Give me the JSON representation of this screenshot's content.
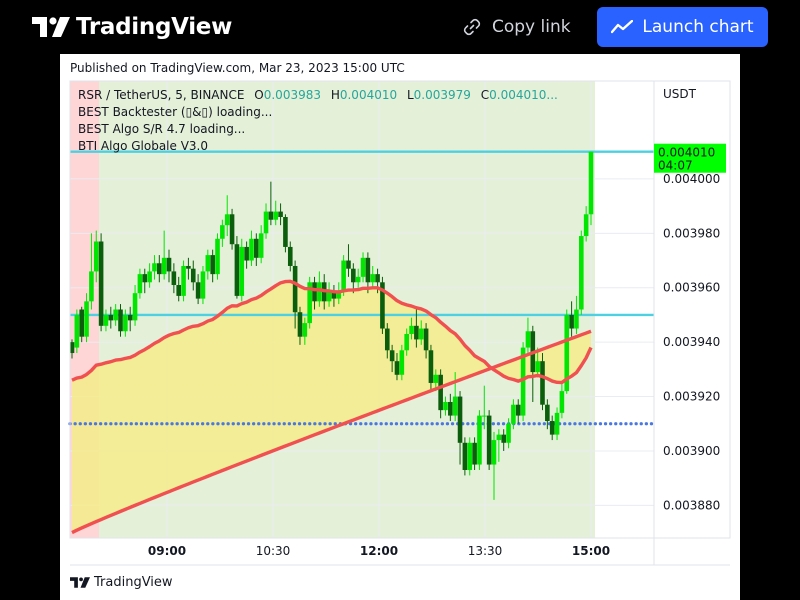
{
  "header": {
    "brand_name": "TradingView",
    "copy_link_label": "Copy link",
    "launch_chart_label": "Launch chart",
    "accent_color": "#2962ff"
  },
  "published_text": "Published on TradingView.com, Mar 23, 2023 15:00 UTC",
  "legend": {
    "symbol": "RSR / TetherUS, 5, BINANCE",
    "open_label": "O",
    "open": "0.003983",
    "high_label": "H",
    "high": "0.004010",
    "low_label": "L",
    "low": "0.003979",
    "close_label": "C",
    "close": "0.004010...",
    "indicators": [
      "BEST Backtester (▯&▯) loading...",
      "BEST Algo S/R 4.7 loading...",
      "BTI Algo Globale V3.0"
    ]
  },
  "footer_brand": "TradingView",
  "chart_data": {
    "type": "candlestick",
    "currency": "USDT",
    "x_ticks": [
      "09:00",
      "10:30",
      "12:00",
      "13:30",
      "15:00"
    ],
    "bold_x_ticks": [
      "09:00",
      "12:00",
      "15:00"
    ],
    "ylim": [
      0.003868,
      0.004036
    ],
    "y_ticks": [
      0.00388,
      0.0039,
      0.00392,
      0.00394,
      0.00396,
      0.00398,
      0.004
    ],
    "last_price": {
      "value": 0.00401,
      "label": "0.004010",
      "countdown": "04:07"
    },
    "support_resistance_levels": [
      0.00401,
      0.00395
    ],
    "dotted_level": 0.00391,
    "colors": {
      "bull_candle": "#00e600",
      "bear_candle": "#0b5e0b",
      "level_line": "#4dd0e1",
      "dotted_level": "#4a78e0",
      "moving_average": "#f05050",
      "cloud_fill": "#f5ec8a",
      "bull_zone": "#e5f0d9",
      "bear_zone": "#ffd6d6",
      "price_label_bg": "#00ff00"
    },
    "candles": [
      [
        0.00394,
        0.003936,
        0.003941,
        0.003934
      ],
      [
        0.003938,
        0.00395,
        0.003952,
        0.003936
      ],
      [
        0.003952,
        0.003942,
        0.003953,
        0.00394
      ],
      [
        0.003942,
        0.003955,
        0.003958,
        0.00394
      ],
      [
        0.003955,
        0.003966,
        0.00398,
        0.003952
      ],
      [
        0.003966,
        0.003977,
        0.003981,
        0.003962
      ],
      [
        0.003977,
        0.003946,
        0.00398,
        0.003944
      ],
      [
        0.003946,
        0.00395,
        0.003952,
        0.003944
      ],
      [
        0.00395,
        0.003948,
        0.003953,
        0.003945
      ],
      [
        0.003948,
        0.003952,
        0.003954,
        0.003946
      ],
      [
        0.003952,
        0.003944,
        0.003954,
        0.003942
      ],
      [
        0.003944,
        0.00395,
        0.003952,
        0.003942
      ],
      [
        0.00395,
        0.003948,
        0.003953,
        0.003944
      ],
      [
        0.003948,
        0.003958,
        0.003961,
        0.003946
      ],
      [
        0.003958,
        0.003965,
        0.003967,
        0.003956
      ],
      [
        0.003965,
        0.003962,
        0.003967,
        0.003958
      ],
      [
        0.003962,
        0.003966,
        0.003969,
        0.00396
      ],
      [
        0.003966,
        0.003969,
        0.003972,
        0.003963
      ],
      [
        0.003969,
        0.003965,
        0.003972,
        0.003962
      ],
      [
        0.003965,
        0.003971,
        0.003981,
        0.003963
      ],
      [
        0.003971,
        0.003966,
        0.003974,
        0.003962
      ],
      [
        0.003966,
        0.003961,
        0.003969,
        0.003958
      ],
      [
        0.003961,
        0.003957,
        0.003964,
        0.003955
      ],
      [
        0.003957,
        0.003968,
        0.00397,
        0.003955
      ],
      [
        0.003968,
        0.003967,
        0.003971,
        0.003963
      ],
      [
        0.003967,
        0.003962,
        0.00397,
        0.003959
      ],
      [
        0.003962,
        0.003956,
        0.003965,
        0.003954
      ],
      [
        0.003956,
        0.003966,
        0.003968,
        0.003954
      ],
      [
        0.003966,
        0.003972,
        0.003974,
        0.003963
      ],
      [
        0.003972,
        0.003965,
        0.003974,
        0.003962
      ],
      [
        0.003965,
        0.003978,
        0.00398,
        0.003963
      ],
      [
        0.003978,
        0.003983,
        0.003985,
        0.003975
      ],
      [
        0.003983,
        0.003987,
        0.003994,
        0.003979
      ],
      [
        0.003987,
        0.003976,
        0.003989,
        0.003974
      ],
      [
        0.003976,
        0.003957,
        0.003979,
        0.003956
      ],
      [
        0.003957,
        0.003975,
        0.003978,
        0.003955
      ],
      [
        0.003975,
        0.00397,
        0.003977,
        0.003967
      ],
      [
        0.00397,
        0.003978,
        0.003981,
        0.003968
      ],
      [
        0.003978,
        0.003971,
        0.00398,
        0.003968
      ],
      [
        0.003971,
        0.00398,
        0.003983,
        0.003969
      ],
      [
        0.00398,
        0.003988,
        0.003991,
        0.003978
      ],
      [
        0.003988,
        0.003985,
        0.003999,
        0.003983
      ],
      [
        0.003985,
        0.003988,
        0.003992,
        0.003983
      ],
      [
        0.003988,
        0.003986,
        0.003991,
        0.003983
      ],
      [
        0.003986,
        0.003975,
        0.003987,
        0.003973
      ],
      [
        0.003975,
        0.003968,
        0.003977,
        0.003966
      ],
      [
        0.003968,
        0.003951,
        0.00397,
        0.003945
      ],
      [
        0.003951,
        0.003942,
        0.003953,
        0.003939
      ],
      [
        0.003942,
        0.003947,
        0.003949,
        0.003939
      ],
      [
        0.003947,
        0.003962,
        0.003964,
        0.003945
      ],
      [
        0.003962,
        0.003955,
        0.003964,
        0.003952
      ],
      [
        0.003955,
        0.003962,
        0.003966,
        0.003953
      ],
      [
        0.003962,
        0.003955,
        0.003965,
        0.003952
      ],
      [
        0.003955,
        0.003959,
        0.003962,
        0.003953
      ],
      [
        0.003959,
        0.003956,
        0.003961,
        0.003953
      ],
      [
        0.003956,
        0.003959,
        0.003962,
        0.003954
      ],
      [
        0.003959,
        0.00397,
        0.003972,
        0.003957
      ],
      [
        0.00397,
        0.003967,
        0.003976,
        0.003964
      ],
      [
        0.003967,
        0.003962,
        0.003969,
        0.003958
      ],
      [
        0.003962,
        0.003964,
        0.003967,
        0.00396
      ],
      [
        0.003964,
        0.003971,
        0.003973,
        0.003962
      ],
      [
        0.003971,
        0.003962,
        0.003973,
        0.003958
      ],
      [
        0.003962,
        0.003965,
        0.003968,
        0.00396
      ],
      [
        0.003965,
        0.003962,
        0.003967,
        0.003958
      ],
      [
        0.003962,
        0.003945,
        0.003964,
        0.003943
      ],
      [
        0.003945,
        0.003937,
        0.003947,
        0.003934
      ],
      [
        0.003937,
        0.003933,
        0.003939,
        0.003929
      ],
      [
        0.003933,
        0.003928,
        0.003936,
        0.003926
      ],
      [
        0.003928,
        0.003937,
        0.003939,
        0.003926
      ],
      [
        0.003937,
        0.003943,
        0.003945,
        0.003935
      ],
      [
        0.003943,
        0.003946,
        0.003949,
        0.003941
      ],
      [
        0.003946,
        0.003941,
        0.003952,
        0.003938
      ],
      [
        0.003941,
        0.003945,
        0.003948,
        0.003939
      ],
      [
        0.003945,
        0.003937,
        0.003947,
        0.003934
      ],
      [
        0.003937,
        0.003925,
        0.003939,
        0.003922
      ],
      [
        0.003925,
        0.003928,
        0.00393,
        0.003922
      ],
      [
        0.003928,
        0.003915,
        0.00393,
        0.003912
      ],
      [
        0.003915,
        0.003918,
        0.00392,
        0.003913
      ],
      [
        0.003918,
        0.003913,
        0.003921,
        0.003911
      ],
      [
        0.003913,
        0.00392,
        0.003929,
        0.003911
      ],
      [
        0.00392,
        0.003903,
        0.003922,
        0.003895
      ],
      [
        0.003903,
        0.003893,
        0.003905,
        0.003891
      ],
      [
        0.003893,
        0.003903,
        0.003905,
        0.003891
      ],
      [
        0.003903,
        0.003895,
        0.003905,
        0.003893
      ],
      [
        0.003895,
        0.003913,
        0.003915,
        0.003893
      ],
      [
        0.003913,
        0.003913,
        0.003924,
        0.003908
      ],
      [
        0.003913,
        0.003895,
        0.003915,
        0.003893
      ],
      [
        0.003895,
        0.003904,
        0.003907,
        0.003882
      ],
      [
        0.003904,
        0.003906,
        0.003908,
        0.003896
      ],
      [
        0.003906,
        0.003903,
        0.003908,
        0.0039
      ],
      [
        0.003903,
        0.00391,
        0.003912,
        0.003901
      ],
      [
        0.00391,
        0.003917,
        0.003919,
        0.003908
      ],
      [
        0.003917,
        0.003913,
        0.003919,
        0.00391
      ],
      [
        0.003913,
        0.003938,
        0.00394,
        0.003911
      ],
      [
        0.003938,
        0.003944,
        0.003949,
        0.003936
      ],
      [
        0.003944,
        0.003929,
        0.003946,
        0.003918
      ],
      [
        0.003929,
        0.003933,
        0.003938,
        0.003927
      ],
      [
        0.003933,
        0.003917,
        0.003936,
        0.003915
      ],
      [
        0.003917,
        0.003911,
        0.003919,
        0.003908
      ],
      [
        0.003911,
        0.003906,
        0.003913,
        0.003904
      ],
      [
        0.003906,
        0.003914,
        0.003916,
        0.003904
      ],
      [
        0.003914,
        0.003922,
        0.003925,
        0.003912
      ],
      [
        0.003922,
        0.00395,
        0.003952,
        0.003921
      ],
      [
        0.00395,
        0.003945,
        0.003955,
        0.003942
      ],
      [
        0.003945,
        0.003952,
        0.003957,
        0.003943
      ],
      [
        0.003952,
        0.003979,
        0.003981,
        0.00395
      ],
      [
        0.003979,
        0.003987,
        0.00399,
        0.003977
      ],
      [
        0.003987,
        0.00401,
        0.00401,
        0.003983
      ]
    ]
  }
}
